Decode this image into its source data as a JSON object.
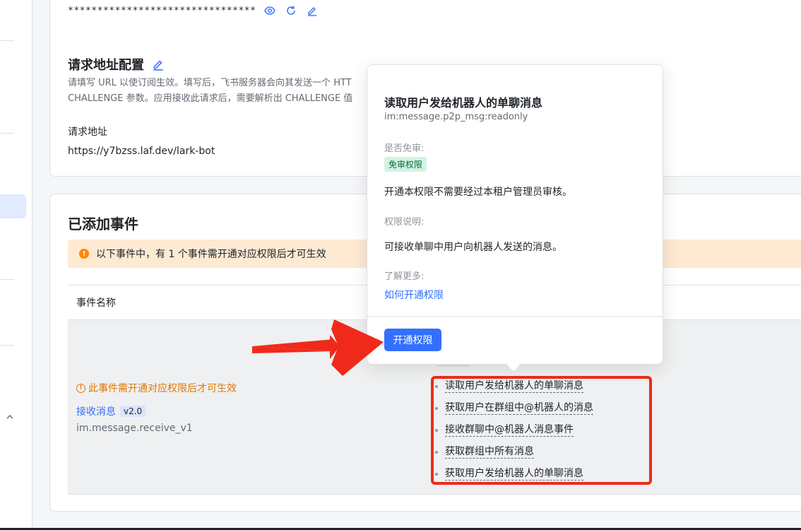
{
  "credentials": {
    "masked_secret": "********************************",
    "show_icon": "eye-icon",
    "refresh_icon": "refresh-icon",
    "edit_icon": "edit-icon"
  },
  "request_config": {
    "title": "请求地址配置",
    "edit_icon": "edit-icon",
    "description_line1": "请填写 URL 以使订阅生效。填写后，飞书服务器会向其发送一个 HTT",
    "description_line2": "CHALLENGE 参数。应用接收此请求后，需要解析出 CHALLENGE 值",
    "url_label": "请求地址",
    "url_value": "https://y7bzss.laf.dev/lark-bot"
  },
  "events": {
    "title": "已添加事件",
    "warning": "以下事件中，有 1 个事件需开通对应权限后才可生效",
    "column_event_name": "事件名称",
    "row": {
      "warning": "此事件需开通对应权限后才可生效",
      "event_name": "接收消息",
      "version": "v2.0",
      "event_key": "im.message.receive_v1",
      "permissions": [
        "读取用户发给机器人的单聊消息",
        "获取用户在群组中@机器人的消息",
        "接收群聊中@机器人消息事件",
        "获取群组中所有消息",
        "获取用户发给机器人的单聊消息"
      ]
    }
  },
  "popover": {
    "title": "读取用户发给机器人的单聊消息",
    "scope": "im:message.p2p_msg:readonly",
    "review_label": "是否免审:",
    "review_tag": "免审权限",
    "review_text": "开通本权限不需要经过本租户管理员审核。",
    "desc_label": "权限说明:",
    "desc_text": "可接收单聊中用户向机器人发送的消息。",
    "more_label": "了解更多:",
    "more_link": "如何开通权限",
    "action_button": "开通权限"
  },
  "colors": {
    "accent": "#3370ff",
    "warning_bg": "#feead2",
    "warning_text": "#de7802",
    "annotation_red": "#f02a1a",
    "tag_green_bg": "#d3f3e2"
  }
}
